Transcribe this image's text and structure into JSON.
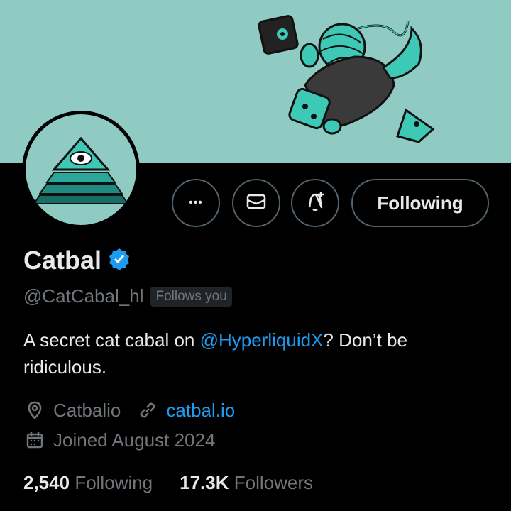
{
  "profile": {
    "name": "Catbal",
    "handle": "@CatCabal_hl",
    "follows_you": "Follows you",
    "bio_prefix": "A secret cat cabal on ",
    "bio_mention": "@HyperliquidX",
    "bio_suffix": "? Don’t be ridiculous.",
    "location": "Catbalio",
    "website": "catbal.io",
    "joined": "Joined August 2024",
    "following_count": "2,540",
    "following_label": "Following",
    "followers_count": "17.3K",
    "followers_label": "Followers"
  },
  "actions": {
    "more_label": "•••",
    "follow_state": "Following"
  },
  "colors": {
    "banner": "#8fcbc3",
    "accent": "#1d9bf0",
    "verified": "#1d9bf0",
    "muted": "#71767b"
  },
  "icons": [
    "more-icon",
    "message-icon",
    "notify-icon",
    "verified-icon",
    "location-icon",
    "link-icon",
    "calendar-icon"
  ]
}
